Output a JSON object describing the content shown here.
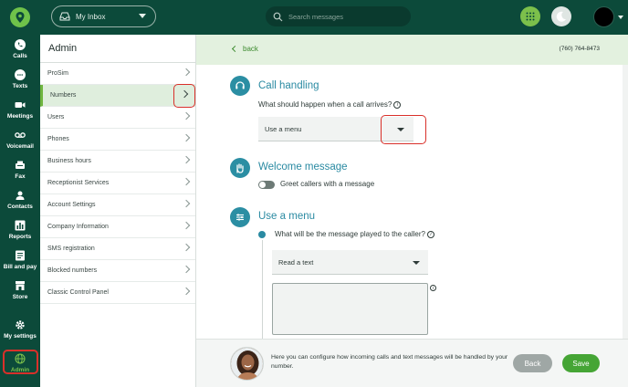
{
  "header": {
    "inbox_label": "My Inbox",
    "search_placeholder": "Search messages"
  },
  "leftnav": {
    "items": [
      {
        "label": "Calls",
        "icon": "phone-icon"
      },
      {
        "label": "Texts",
        "icon": "chat-icon"
      },
      {
        "label": "Meetings",
        "icon": "video-icon"
      },
      {
        "label": "Voicemail",
        "icon": "voicemail-icon"
      },
      {
        "label": "Fax",
        "icon": "fax-icon"
      },
      {
        "label": "Contacts",
        "icon": "contacts-icon"
      },
      {
        "label": "Reports",
        "icon": "chart-icon"
      },
      {
        "label": "Bill and pay",
        "icon": "bill-icon"
      },
      {
        "label": "Store",
        "icon": "store-icon"
      },
      {
        "label": "My settings",
        "icon": "gear-icon"
      },
      {
        "label": "Admin",
        "icon": "globe-icon"
      }
    ]
  },
  "admin": {
    "title": "Admin",
    "items": [
      "ProSim",
      "Numbers",
      "Users",
      "Phones",
      "Business hours",
      "Receptionist Services",
      "Account Settings",
      "Company Information",
      "SMS registration",
      "Blocked numbers",
      "Classic Control Panel"
    ],
    "active": "Numbers"
  },
  "main": {
    "back_label": "back",
    "phone_number": "(760) 764-8473",
    "call_handling": {
      "title": "Call handling",
      "question": "What should happen when a call arrives?",
      "selected": "Use a menu"
    },
    "welcome": {
      "title": "Welcome message",
      "toggle_label": "Greet callers with a message"
    },
    "menu": {
      "title": "Use a menu",
      "question": "What will be the message played to the caller?",
      "selected": "Read a text",
      "text_value": ""
    }
  },
  "footer": {
    "help_text": "Here you can configure how incoming calls and text messages will be handled by your number.",
    "back_label": "Back",
    "save_label": "Save"
  },
  "colors": {
    "brand_dark": "#0c4a3a",
    "brand_green": "#7cc04b",
    "accent_teal": "#2a8aa2",
    "highlight_red": "#d9302a"
  }
}
